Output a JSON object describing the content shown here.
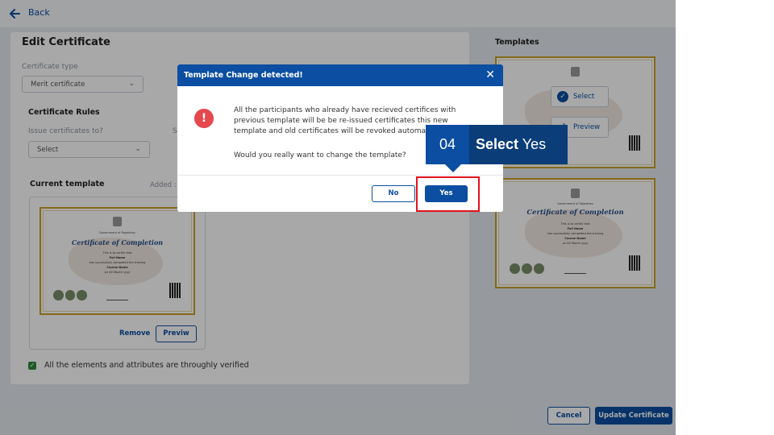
{
  "nav": {
    "back_label": "Back"
  },
  "form": {
    "title": "Edit Certificate",
    "certificate_type_label": "Certificate type",
    "certificate_type_value": "Merit certificate",
    "rules_heading": "Certificate Rules",
    "issue_to_label": "Issue certificates to?",
    "issue_to_second_label": "S",
    "issue_to_value": "Select",
    "current_template_heading": "Current template",
    "added_label": "Added :",
    "remove_label": "Remove",
    "preview_label": "Previw",
    "verify_label": "All the elements and attributes are throughly verified"
  },
  "templates": {
    "heading": "Templates",
    "select_label": "Select",
    "preview_label": "Preview"
  },
  "certificate": {
    "gov_line": "Government of Rajasthan",
    "title": "Certificate of Completion",
    "certify_line": "This is to certify that",
    "name": "Full Name",
    "completed_line": "has successfully completed the training",
    "course": "Course Name",
    "date": "on XX Month yyyy"
  },
  "footer": {
    "cancel_label": "Cancel",
    "update_label": "Update Certificate"
  },
  "modal": {
    "title": "Template Change detected!",
    "close_glyph": "✕",
    "alert_glyph": "!",
    "message": "All the participants who already have recieved certifices with previous template will be be re-issued certificates this new template and old certificates will be revoked automati",
    "question": "Would you really want to change the template?",
    "no_label": "No",
    "yes_label": "Yes"
  },
  "callout": {
    "step": "04",
    "action": "Select",
    "target": "Yes"
  },
  "colors": {
    "primary": "#0b4ea2",
    "callout_dark": "#0b3d78",
    "highlight": "#e3131b",
    "alert": "#e5484d",
    "check": "#2e8b3a"
  }
}
